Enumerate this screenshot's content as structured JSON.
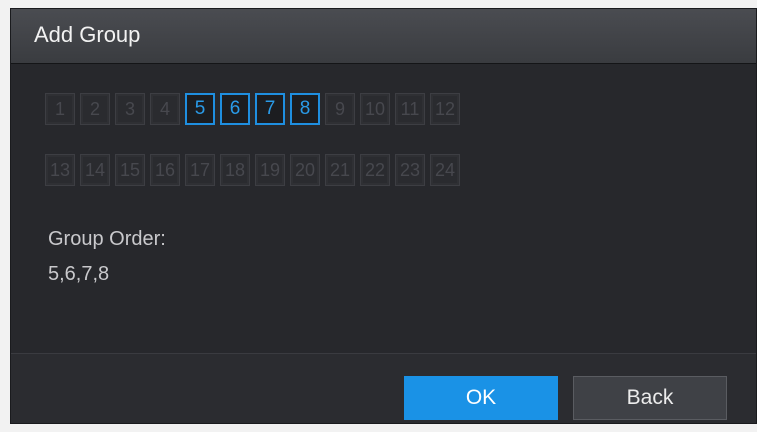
{
  "dialog": {
    "title": "Add Group",
    "channels": [
      {
        "label": "1",
        "selected": false
      },
      {
        "label": "2",
        "selected": false
      },
      {
        "label": "3",
        "selected": false
      },
      {
        "label": "4",
        "selected": false
      },
      {
        "label": "5",
        "selected": true
      },
      {
        "label": "6",
        "selected": true
      },
      {
        "label": "7",
        "selected": true
      },
      {
        "label": "8",
        "selected": true
      },
      {
        "label": "9",
        "selected": false
      },
      {
        "label": "10",
        "selected": false
      },
      {
        "label": "11",
        "selected": false
      },
      {
        "label": "12",
        "selected": false
      },
      {
        "label": "13",
        "selected": false
      },
      {
        "label": "14",
        "selected": false
      },
      {
        "label": "15",
        "selected": false
      },
      {
        "label": "16",
        "selected": false
      },
      {
        "label": "17",
        "selected": false
      },
      {
        "label": "18",
        "selected": false
      },
      {
        "label": "19",
        "selected": false
      },
      {
        "label": "20",
        "selected": false
      },
      {
        "label": "21",
        "selected": false
      },
      {
        "label": "22",
        "selected": false
      },
      {
        "label": "23",
        "selected": false
      },
      {
        "label": "24",
        "selected": false
      }
    ],
    "group_order_label": "Group Order:",
    "group_order_value": "5,6,7,8",
    "ok_label": "OK",
    "back_label": "Back"
  },
  "colors": {
    "accent": "#1a92e6",
    "selected_text": "#2a9be8",
    "panel_bg": "#27282c"
  }
}
